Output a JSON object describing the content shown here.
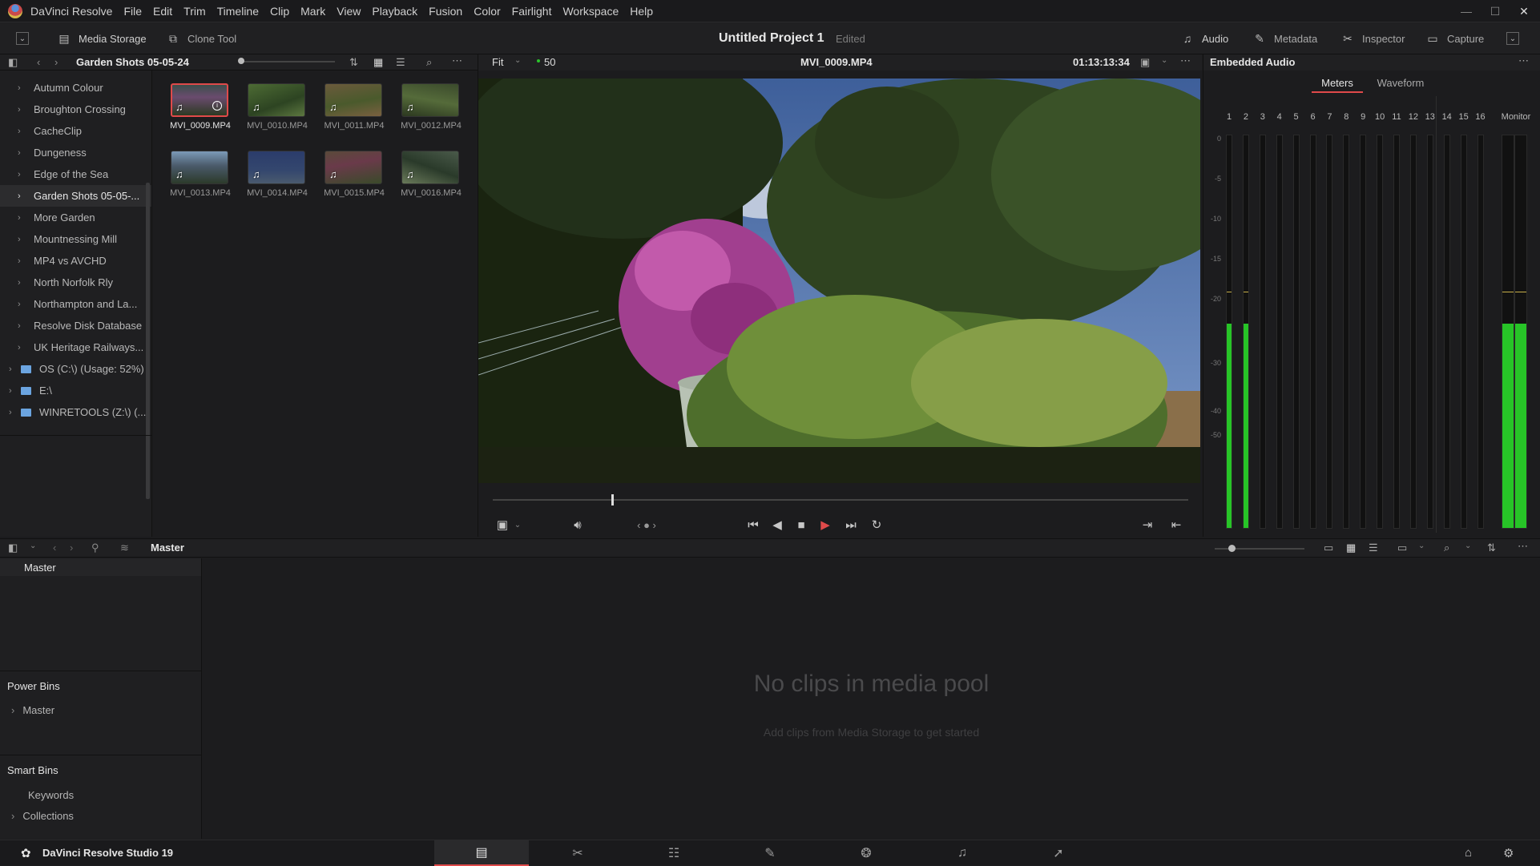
{
  "menubar": {
    "app_name": "DaVinci Resolve",
    "items": [
      "File",
      "Edit",
      "Trim",
      "Timeline",
      "Clip",
      "Mark",
      "View",
      "Playback",
      "Fusion",
      "Color",
      "Fairlight",
      "Workspace",
      "Help"
    ]
  },
  "toolbar": {
    "media_storage": "Media Storage",
    "clone_tool": "Clone Tool",
    "project_title": "Untitled Project 1",
    "project_status": "Edited",
    "audio": "Audio",
    "metadata": "Metadata",
    "inspector": "Inspector",
    "capture": "Capture"
  },
  "storage": {
    "current_folder": "Garden Shots 05-05-24",
    "folders": [
      "Autumn Colour",
      "Broughton Crossing",
      "CacheClip",
      "Dungeness",
      "Edge of the Sea",
      "Garden Shots 05-05-...",
      "More Garden",
      "Mountnessing Mill",
      "MP4 vs AVCHD",
      "North Norfolk Rly",
      "Northampton and La...",
      "Resolve Disk Database",
      "UK Heritage Railways..."
    ],
    "drives": [
      "OS (C:\\) (Usage: 52%)",
      "E:\\",
      "WINRETOOLS (Z:\\) (..."
    ],
    "clips": [
      "MVI_0009.MP4",
      "MVI_0010.MP4",
      "MVI_0011.MP4",
      "MVI_0012.MP4",
      "MVI_0013.MP4",
      "MVI_0014.MP4",
      "MVI_0015.MP4",
      "MVI_0016.MP4"
    ]
  },
  "viewer": {
    "zoom": "Fit",
    "fps": "50",
    "clip_name": "MVI_0009.MP4",
    "timecode": "01:13:13:34",
    "scrub_progress": 0.17
  },
  "audio_panel": {
    "title": "Embedded Audio",
    "tabs": [
      "Meters",
      "Waveform"
    ],
    "active_tab": "Meters",
    "channels": [
      "1",
      "2",
      "3",
      "4",
      "5",
      "6",
      "7",
      "8",
      "9",
      "10",
      "11",
      "12",
      "13",
      "14",
      "15",
      "16"
    ],
    "monitor_label": "Monitor",
    "db_scale": [
      "0",
      "-5",
      "-10",
      "-15",
      "-20",
      "-30",
      "-40",
      "-50"
    ],
    "levels_fraction": [
      0.52,
      0.52,
      0,
      0,
      0,
      0,
      0,
      0,
      0,
      0,
      0,
      0,
      0,
      0,
      0,
      0
    ],
    "monitor_level_fraction": 0.52,
    "meter_color": "#27c427"
  },
  "media_pool": {
    "bin_title": "Master",
    "master_bin": "Master",
    "power_bins_title": "Power Bins",
    "power_bins_item": "Master",
    "smart_bins_title": "Smart Bins",
    "smart_bins_items": [
      "Keywords",
      "Collections"
    ],
    "empty_title": "No clips in media pool",
    "empty_hint": "Add clips from Media Storage to get started"
  },
  "bottom_bar": {
    "product": "DaVinci Resolve Studio 19",
    "pages": [
      "media-page",
      "cut-page",
      "edit-page",
      "fusion-page",
      "color-page",
      "fairlight-page",
      "deliver-page"
    ],
    "active_page": "media-page",
    "accent": "#e04a4a"
  }
}
